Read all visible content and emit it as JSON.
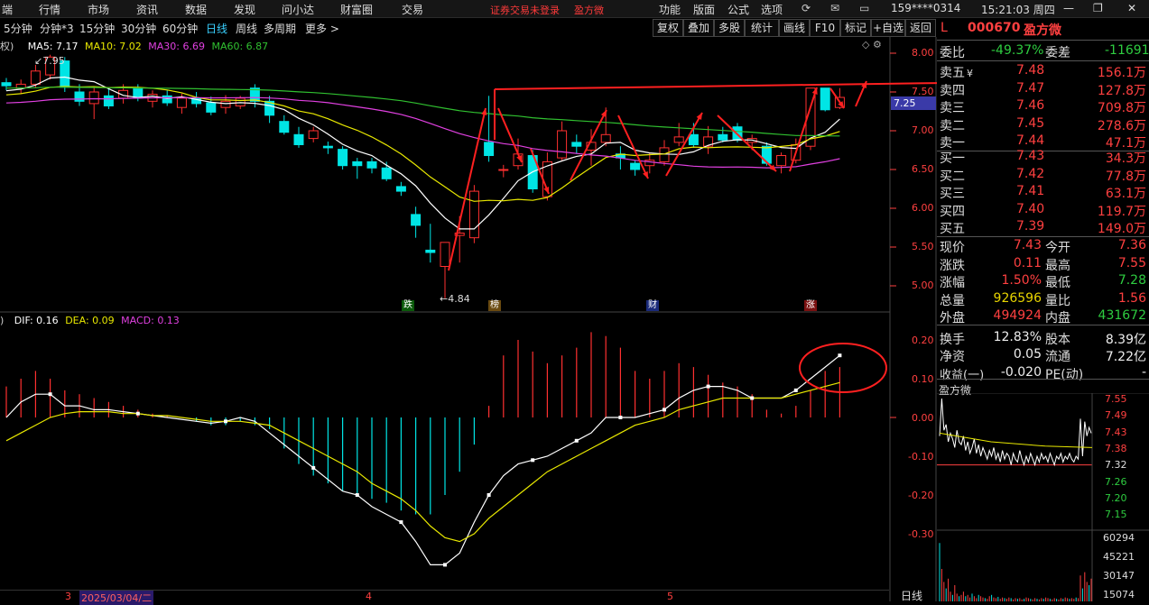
{
  "menu": {
    "items": [
      "端",
      "行情",
      "市场",
      "资讯",
      "数据",
      "发现",
      "问小达",
      "财富圈",
      "交易"
    ],
    "warning": "证券交易未登录",
    "stock_name": "盈方微",
    "right_items": [
      "功能",
      "版面",
      "公式",
      "选项"
    ],
    "account": "159****0314",
    "time": "15:21:03 周四"
  },
  "periods": [
    "5分钟",
    "分钟*3",
    "15分钟",
    "30分钟",
    "60分钟",
    "日线",
    "周线",
    "多周期",
    "更多 >"
  ],
  "active_period": "日线",
  "toolbar": [
    "复权",
    "叠加",
    "多股",
    "统计",
    "画线",
    "F10",
    "标记",
    "+自选",
    "返回"
  ],
  "ma": {
    "prefix": "权)",
    "ma5": "MA5: 7.17",
    "ma10": "MA10: 7.02",
    "ma30": "MA30: 6.69",
    "ma60": "MA60: 6.87"
  },
  "price_axis": [
    "8.00",
    "7.50",
    "7.00",
    "6.50",
    "6.00",
    "5.50",
    "5.00"
  ],
  "price_tag": "7.25",
  "high_label": "7.95",
  "low_label": "4.84",
  "markers": [
    "跌",
    "榜",
    "财",
    "涨"
  ],
  "macd": {
    "prefix": ")",
    "dif": "DIF: 0.16",
    "dea": "DEA: 0.09",
    "macd": "MACD: 0.13"
  },
  "macd_axis": [
    "0.20",
    "0.10",
    "0.00",
    "-0.10",
    "-0.20",
    "-0.30"
  ],
  "date_axis": [
    "3",
    "2025/03/04/二",
    "4",
    "5"
  ],
  "bottom_tab": "日线",
  "quote": {
    "code_marker": "L",
    "code": "000670",
    "name": "盈方微",
    "weibi_label": "委比",
    "weibi": "-49.37%",
    "weicha_label": "委差",
    "weicha": "-11691",
    "asks": [
      {
        "label": "卖五",
        "price": "7.48",
        "vol": "156.1万"
      },
      {
        "label": "卖四",
        "price": "7.47",
        "vol": "127.8万"
      },
      {
        "label": "卖三",
        "price": "7.46",
        "vol": "709.8万"
      },
      {
        "label": "卖二",
        "price": "7.45",
        "vol": "278.6万"
      },
      {
        "label": "卖一",
        "price": "7.44",
        "vol": "47.1万"
      }
    ],
    "ask5_suffix": "¥",
    "bids": [
      {
        "label": "买一",
        "price": "7.43",
        "vol": "34.3万"
      },
      {
        "label": "买二",
        "price": "7.42",
        "vol": "77.8万"
      },
      {
        "label": "买三",
        "price": "7.41",
        "vol": "63.1万"
      },
      {
        "label": "买四",
        "price": "7.40",
        "vol": "119.7万"
      },
      {
        "label": "买五",
        "price": "7.39",
        "vol": "149.0万"
      }
    ],
    "stats": [
      {
        "l1": "现价",
        "v1": "7.43",
        "l2": "今开",
        "v2": "7.36",
        "c1": "red",
        "c2": "red"
      },
      {
        "l1": "涨跌",
        "v1": "0.11",
        "l2": "最高",
        "v2": "7.55",
        "c1": "red",
        "c2": "red"
      },
      {
        "l1": "涨幅",
        "v1": "1.50%",
        "l2": "最低",
        "v2": "7.28",
        "c1": "red",
        "c2": "grn"
      },
      {
        "l1": "总量",
        "v1": "926596",
        "l2": "量比",
        "v2": "1.56",
        "c1": "yel",
        "c2": "red"
      },
      {
        "l1": "外盘",
        "v1": "494924",
        "l2": "内盘",
        "v2": "431672",
        "c1": "red",
        "c2": "grn"
      },
      {
        "l1": "换手",
        "v1": "12.83%",
        "l2": "股本",
        "v2": "8.39亿",
        "c1": "wht",
        "c2": "wht"
      },
      {
        "l1": "净资",
        "v1": "0.05",
        "l2": "流通",
        "v2": "7.22亿",
        "c1": "wht",
        "c2": "wht"
      },
      {
        "l1": "收益(一)",
        "v1": "-0.020",
        "l2": "PE(动)",
        "v2": "-",
        "c1": "wht",
        "c2": "wht"
      }
    ]
  },
  "mini": {
    "title": "盈方微",
    "price_axis": [
      "7.55",
      "7.49",
      "7.43",
      "7.38",
      "7.32",
      "7.26",
      "7.20",
      "7.15"
    ],
    "vol_axis": [
      "60294",
      "45221",
      "30147",
      "15074"
    ]
  },
  "colors": {
    "up": "#ff3030",
    "down": "#00e5e5",
    "ma5": "#ffffff",
    "ma10": "#e8e800",
    "ma30": "#e040e0",
    "ma60": "#30c030",
    "annotation": "#ff2020"
  }
}
